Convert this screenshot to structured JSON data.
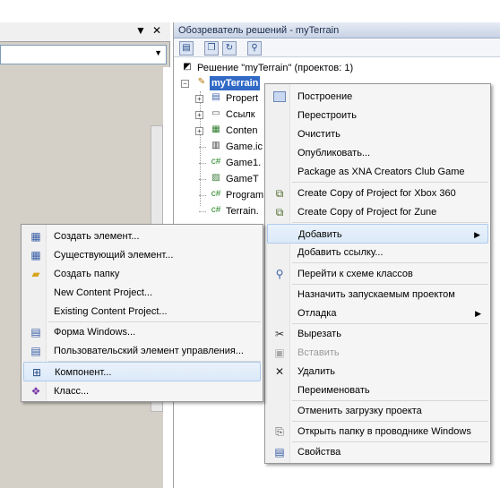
{
  "left_pane": {
    "header_buttons": [
      "▼",
      "✕"
    ]
  },
  "solution_explorer": {
    "title": "Обозреватель решений - myTerrain",
    "solution_label": "Решение \"myTerrain\"  (проектов: 1)",
    "project_label": "myTerrain",
    "tree_items": [
      "Propert",
      "Ссылк",
      "Conten",
      "Game.ic",
      "Game1.",
      "GameT",
      "Program",
      "Terrain."
    ]
  },
  "project_menu": {
    "items": [
      {
        "label": "Построение",
        "icon": "build-icon"
      },
      {
        "label": "Перестроить"
      },
      {
        "label": "Очистить"
      },
      {
        "label": "Опубликовать..."
      },
      {
        "label": "Package as XNA Creators Club Game"
      },
      {
        "label": "Create Copy of Project for Xbox 360",
        "icon": "xbox-copy-icon"
      },
      {
        "label": "Create Copy of Project for Zune",
        "icon": "zune-copy-icon"
      },
      {
        "label": "Добавить",
        "submenu": true,
        "highlighted": true
      },
      {
        "label": "Добавить ссылку..."
      },
      {
        "label": "Перейти к схеме классов",
        "icon": "class-diagram-icon"
      },
      {
        "label": "Назначить запускаемым проектом"
      },
      {
        "label": "Отладка",
        "submenu": true
      },
      {
        "label": "Вырезать",
        "icon": "scissors-icon"
      },
      {
        "label": "Вставить",
        "icon": "paste-icon",
        "disabled": true
      },
      {
        "label": "Удалить",
        "icon": "delete-icon"
      },
      {
        "label": "Переименовать"
      },
      {
        "label": "Отменить загрузку проекта"
      },
      {
        "label": "Открыть папку в проводнике Windows",
        "icon": "folder-open-icon"
      },
      {
        "label": "Свойства",
        "icon": "properties-icon"
      }
    ]
  },
  "add_submenu": {
    "items": [
      {
        "label": "Создать элемент...",
        "icon": "new-item-icon"
      },
      {
        "label": "Существующий элемент...",
        "icon": "existing-item-icon"
      },
      {
        "label": "Создать папку",
        "icon": "folder-icon"
      },
      {
        "label": "New Content Project..."
      },
      {
        "label": "Existing Content Project..."
      },
      {
        "label": "Форма Windows...",
        "icon": "form-icon"
      },
      {
        "label": "Пользовательский элемент управления...",
        "icon": "user-control-icon"
      },
      {
        "label": "Компонент...",
        "icon": "component-icon",
        "highlighted": true
      },
      {
        "label": "Класс...",
        "icon": "class-icon"
      }
    ]
  },
  "colors": {
    "selection": "#3169c6",
    "menu_highlight": "#dbe9f8"
  }
}
